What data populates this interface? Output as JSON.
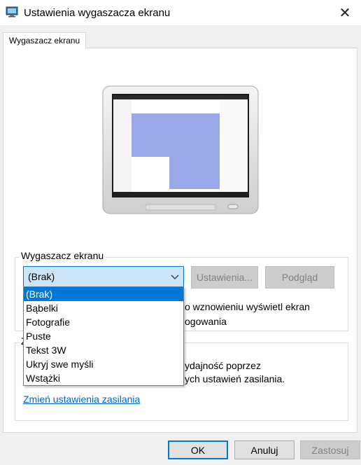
{
  "window": {
    "title": "Ustawienia wygaszacza ekranu",
    "close_glyph": "✕"
  },
  "tabs": [
    {
      "label": "Wygaszacz ekranu",
      "active": true
    }
  ],
  "screensaver_group": {
    "label": "Wygaszacz ekranu",
    "selected_value": "(Brak)",
    "settings_button": "Ustawienia...",
    "preview_button": "Podgląd",
    "resume_text_visible": "o wznowieniu wyświetl ekran",
    "login_text_visible": "ogowania"
  },
  "dropdown": {
    "options": [
      "(Brak)",
      "Bąbelki",
      "Fotografie",
      "Puste",
      "Tekst 3W",
      "Ukryj swe myśli",
      "Wstążki"
    ],
    "selected_index": 0
  },
  "power_group": {
    "label_visible": "Z",
    "text_line1_visible": "ydajność poprzez",
    "text_line2_visible": "ych ustawień zasilania.",
    "link": "Zmień ustawienia zasilania"
  },
  "footer": {
    "ok": "OK",
    "cancel": "Anuluj",
    "apply": "Zastosuj"
  },
  "colors": {
    "accent": "#0078d7",
    "combo_bg": "#cce4f7",
    "link": "#0066cc",
    "dialog_bg": "#f0f0f0"
  },
  "icons": {
    "title": "screensaver-monitor-icon",
    "close": "close-icon",
    "combo": "chevron-down-icon"
  }
}
